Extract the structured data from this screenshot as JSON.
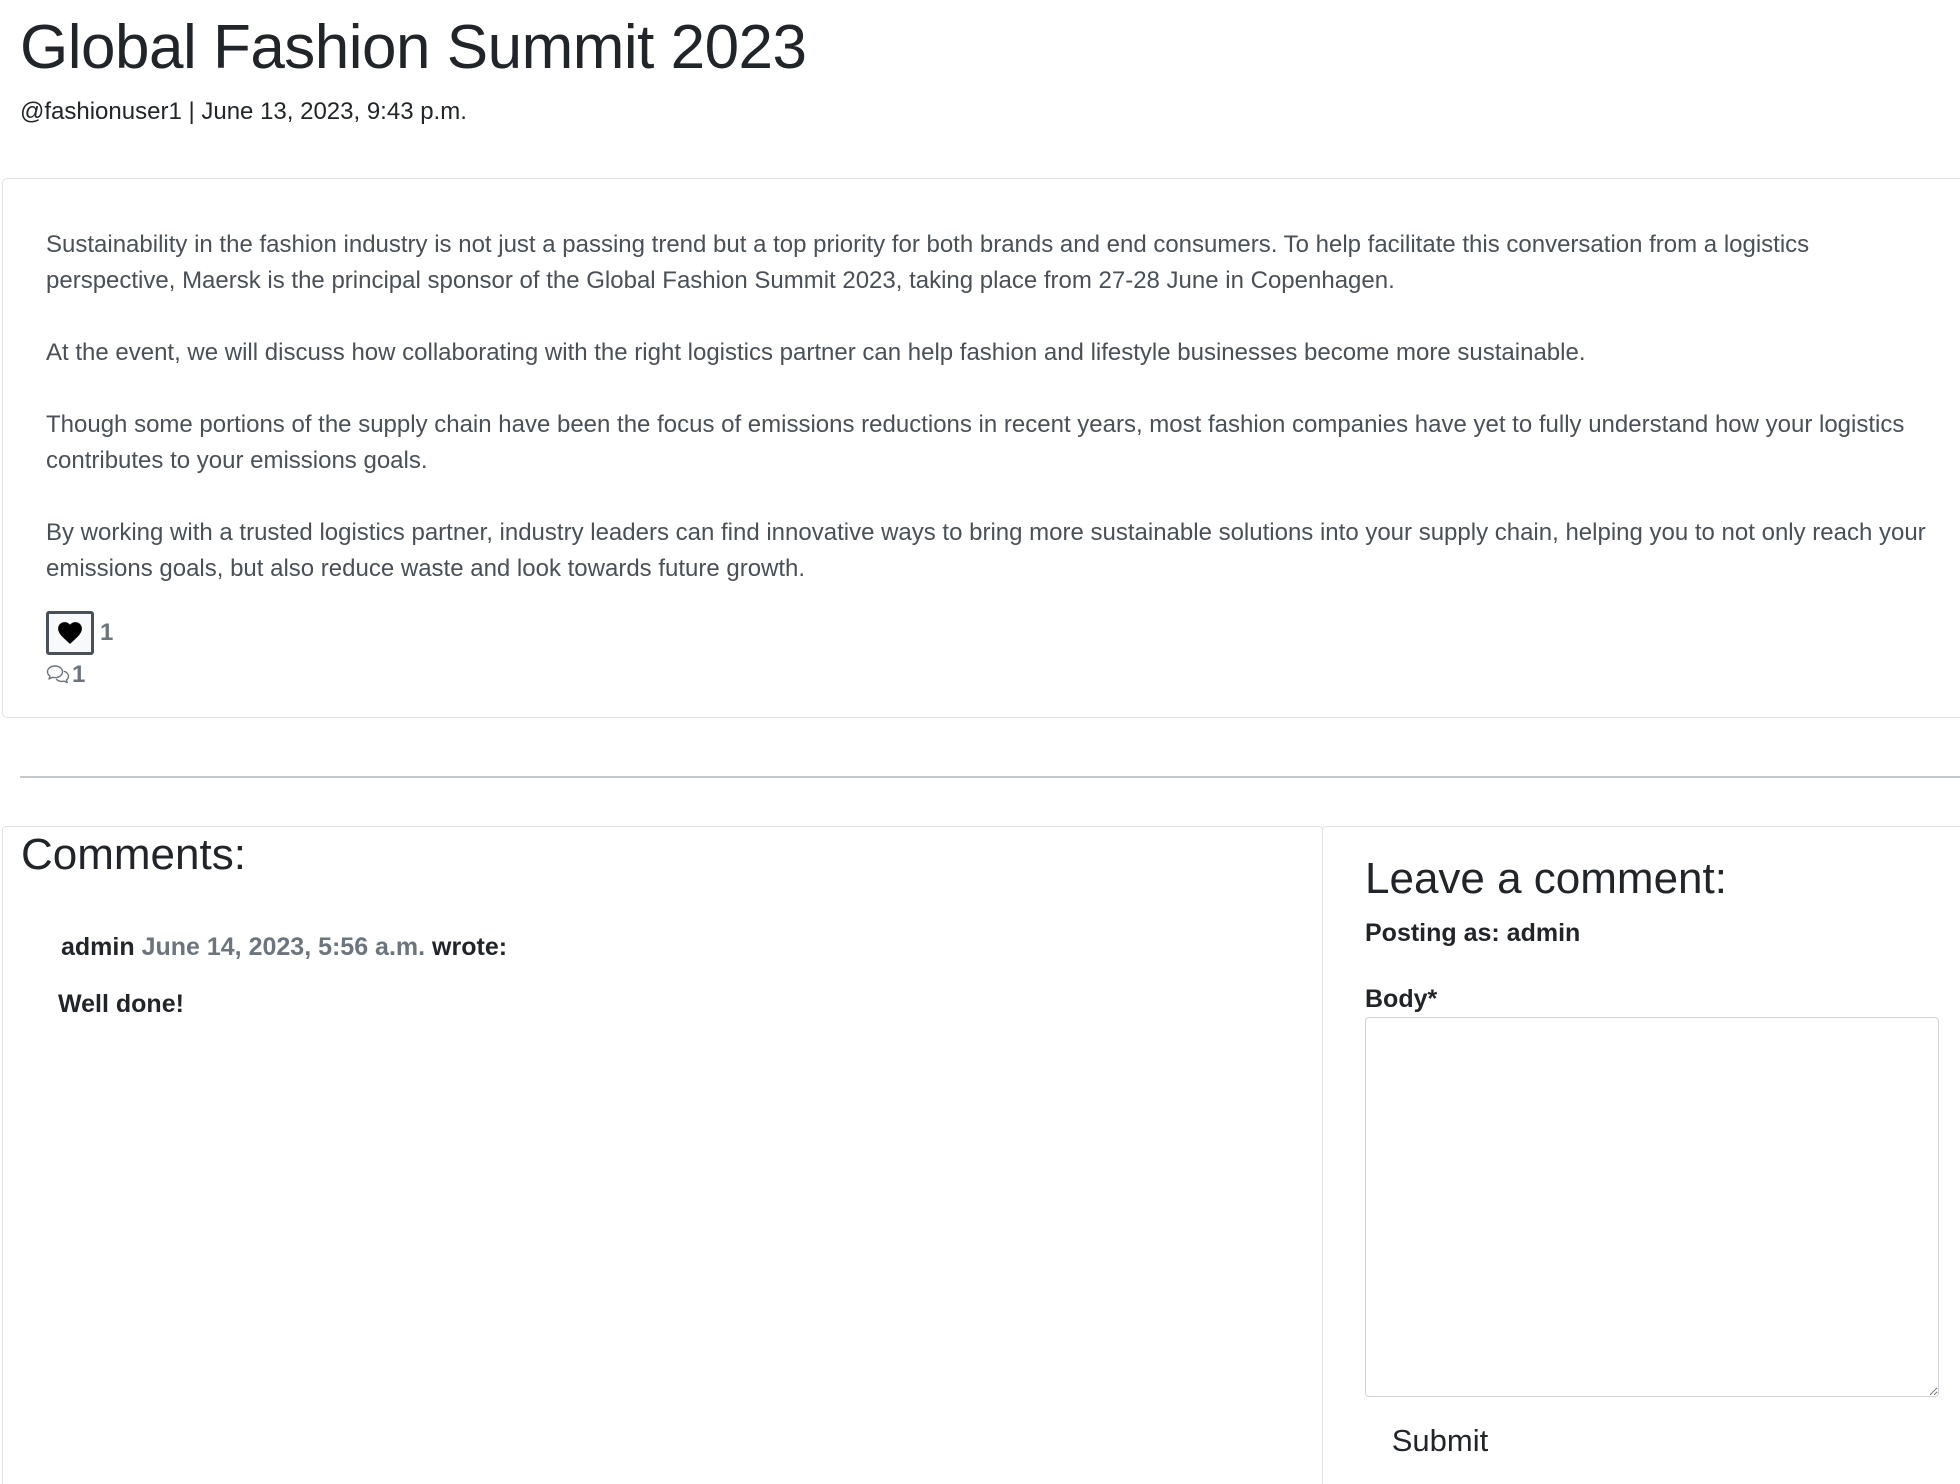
{
  "post": {
    "title": "Global Fashion Summit 2023",
    "meta": "@fashionuser1 | June 13, 2023, 9:43 p.m.",
    "paragraphs": [
      "Sustainability in the fashion industry is not just a passing trend but a top priority for both brands and end consumers. To help facilitate this conversation from a logistics perspective, Maersk is the principal sponsor of the Global Fashion Summit 2023, taking place from 27-28 June in Copenhagen.",
      "At the event, we will discuss how collaborating with the right logistics partner can help fashion and lifestyle businesses become more sustainable.",
      "Though some portions of the supply chain have been the focus of emissions reductions in recent years, most fashion companies have yet to fully understand how your logistics contributes to your emissions goals.",
      "By working with a trusted logistics partner, industry leaders can find innovative ways to bring more sustainable solutions into your supply chain, helping you to not only reach your emissions goals, but also reduce waste and look towards future growth."
    ],
    "like_count": "1",
    "comment_count": "1",
    "icons": {
      "like": "heart-icon",
      "comments": "chat-bubbles-icon"
    }
  },
  "comments": {
    "heading": "Comments:",
    "items": [
      {
        "author": "admin",
        "date": "June 14, 2023, 5:56 a.m.",
        "wrote": "wrote:",
        "body": "Well done!"
      }
    ]
  },
  "form": {
    "heading": "Leave a comment:",
    "posting_as": "Posting as: admin",
    "body_label": "Body*",
    "body_value": "",
    "submit_label": "Submit"
  },
  "colors": {
    "text": "#212529",
    "muted": "#6c757d",
    "body_text": "#495057",
    "border": "#dfe2e6"
  }
}
